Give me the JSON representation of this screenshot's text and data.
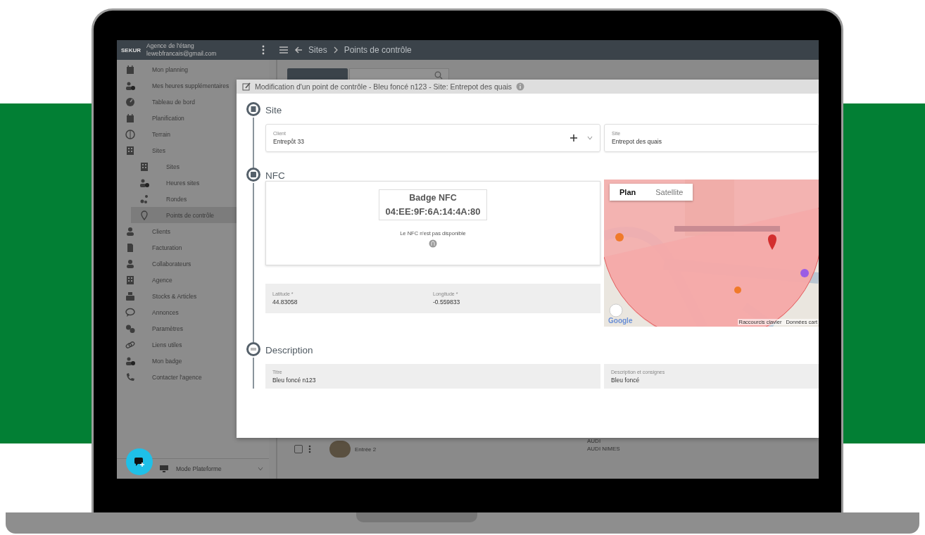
{
  "sidebar": {
    "logo": "SEKUR",
    "agency": "Agence de l'étang",
    "email": "lewebfrancais@gmail.com",
    "items": [
      {
        "label": "Mon planning",
        "selected": false
      },
      {
        "label": "Mes heures supplémentaires",
        "selected": false
      },
      {
        "label": "Tableau de bord",
        "selected": false
      },
      {
        "label": "Planification",
        "selected": false
      },
      {
        "label": "Terrain",
        "selected": false
      },
      {
        "label": "Sites",
        "selected": false,
        "children": [
          {
            "label": "Sites",
            "selected": false
          },
          {
            "label": "Heures sites",
            "selected": false
          },
          {
            "label": "Rondes",
            "selected": false
          },
          {
            "label": "Points de contrôle",
            "selected": true
          }
        ]
      },
      {
        "label": "Clients",
        "selected": false
      },
      {
        "label": "Facturation",
        "selected": false
      },
      {
        "label": "Collaborateurs",
        "selected": false
      },
      {
        "label": "Agence",
        "selected": false
      },
      {
        "label": "Stocks & Articles",
        "selected": false
      },
      {
        "label": "Annonces",
        "selected": false
      },
      {
        "label": "Paramètres",
        "selected": false
      },
      {
        "label": "Liens utiles",
        "selected": false
      },
      {
        "label": "Mon badge",
        "selected": false
      },
      {
        "label": "Contacter l'agence",
        "selected": false
      }
    ],
    "mode": "Mode Plateforme"
  },
  "topbar": {
    "breadcrumb": [
      "Sites",
      "Points de contrôle"
    ]
  },
  "table": {
    "rows": [
      {
        "checked": false,
        "name": "Entrée 2",
        "client": "AUDI",
        "site": "AUDI NIMES"
      }
    ]
  },
  "dialog": {
    "title": "Modification d'un point de contrôle - Bleu foncé n123 - Site: Entrepot des quais",
    "site_section": {
      "title": "Site",
      "client": {
        "label": "Client",
        "value": "Entrepôt 33"
      },
      "site": {
        "label": "Site",
        "value": "Entrepot des quais"
      }
    },
    "nfc_section": {
      "title": "NFC",
      "badge_title": "Badge NFC",
      "badge_id": "04:EE:9F:6A:14:4A:80",
      "status": "Le NFC n'est pas disponible",
      "latitude": {
        "label": "Latitude *",
        "value": "44.83058"
      },
      "longitude": {
        "label": "Longitude *",
        "value": "-0.559833"
      },
      "map": {
        "types": [
          {
            "label": "Plan",
            "selected": true
          },
          {
            "label": "Satellite",
            "selected": false
          }
        ],
        "logo": "Google",
        "footer": [
          "Raccourcis clavier",
          "Données cart"
        ]
      }
    },
    "description_section": {
      "title": "Description",
      "title_field": {
        "label": "Titre",
        "value": "Bleu foncé n123"
      },
      "description_field": {
        "label": "Description et consignes",
        "value": "Bleu foncé"
      }
    }
  }
}
